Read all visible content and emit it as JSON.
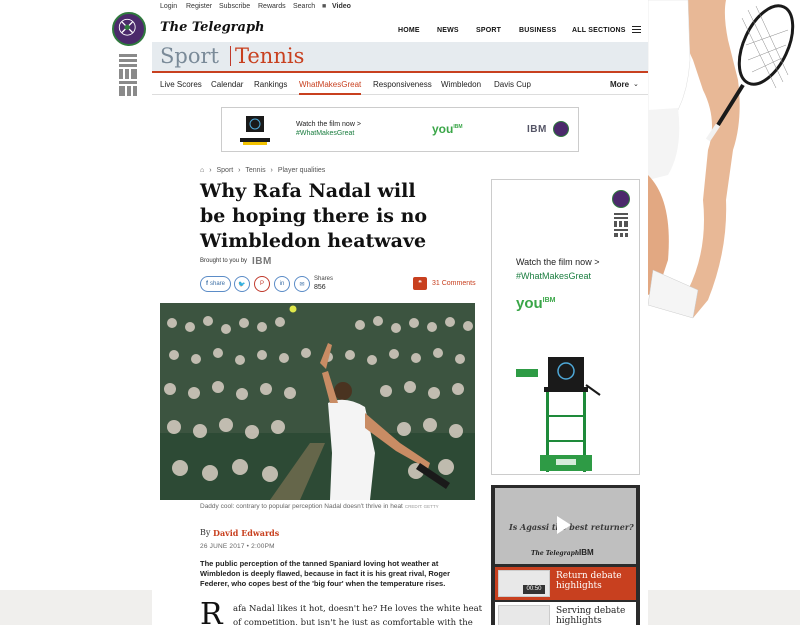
{
  "util": {
    "login": "Login",
    "register": "Register",
    "subscribe": "Subscribe",
    "rewards": "Rewards",
    "search": "Search",
    "video": "Video"
  },
  "masthead": {
    "logo": "The Telegraph",
    "nav": [
      "HOME",
      "NEWS",
      "SPORT",
      "BUSINESS",
      "ALL SECTIONS"
    ]
  },
  "section": {
    "parent": "Sport",
    "current": "Tennis"
  },
  "subnav": {
    "items": [
      "Live Scores",
      "Calendar",
      "Rankings",
      "WhatMakesGreat",
      "Responsiveness",
      "Wimbledon",
      "Davis Cup"
    ],
    "more": "More"
  },
  "banner": {
    "watch": "Watch the film now >",
    "tag": "#WhatMakesGreat",
    "you": "you",
    "you_sup": "IBM",
    "ibm": "IBM"
  },
  "article": {
    "breadcrumbs": [
      "Sport",
      "Tennis",
      "Player qualities"
    ],
    "headline": "Why Rafa Nadal will be hoping there is no Wimbledon heatwave",
    "brought_by": "Brought to you by",
    "sponsor": "IBM",
    "share_label": "share",
    "shares_label": "Shares",
    "shares_count": "856",
    "comments": "31 Comments",
    "caption": "Daddy cool: contrary to popular perception Nadal doesn't thrive in heat",
    "credit": "CREDIT: GETTY",
    "by": "By",
    "author": "David Edwards",
    "date": "26 JUNE 2017 • 2:00PM",
    "standfirst": "The public perception of the tanned Spaniard loving hot weather at Wimbledon is deeply flawed, because in fact it is his great rival, Roger Federer, who copes best of the 'big four' when the temperature rises.",
    "dropcap": "R",
    "body": "afa Nadal likes it hot, doesn't he? He loves the white heat of competition, but isn't he just as comfortable with the mercury"
  },
  "mpu": {
    "watch": "Watch the film now >",
    "tag": "#WhatMakesGreat",
    "you": "you",
    "you_sup": "IBM"
  },
  "video": {
    "thumb_title": "Is Agassi the best returner?",
    "brand": "The Telegraph",
    "brand_ibm": "IBM",
    "items": [
      {
        "title": "Return debate highlights",
        "duration": "00:50"
      },
      {
        "title": "Serving debate highlights",
        "duration": ""
      }
    ]
  },
  "colors": {
    "accent": "#c8401f",
    "ibm_green": "#3aa648",
    "wimbledon_purple": "#4b2a6b",
    "section_bg": "#e6ebef"
  }
}
